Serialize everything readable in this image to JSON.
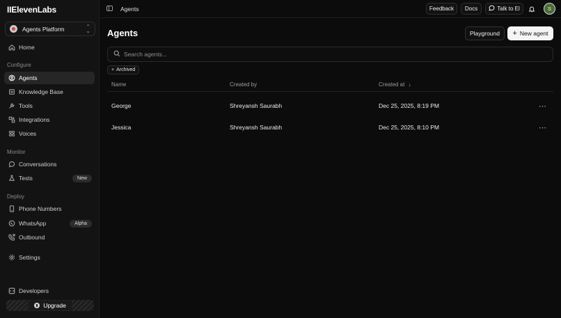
{
  "app": {
    "logo": "IIElevenLabs",
    "workspace": "Agents Platform"
  },
  "sidebar": {
    "home": "Home",
    "configure_label": "Configure",
    "configure": [
      "Agents",
      "Knowledge Base",
      "Tools",
      "Integrations",
      "Voices"
    ],
    "monitor_label": "Monitor",
    "conversations": "Conversations",
    "tests": "Tests",
    "tests_badge": "New",
    "deploy_label": "Deploy",
    "phone_numbers": "Phone Numbers",
    "whatsapp": "WhatsApp",
    "whatsapp_badge": "Alpha",
    "outbound": "Outbound",
    "settings": "Settings",
    "developers": "Developers",
    "upgrade": "Upgrade"
  },
  "topbar": {
    "breadcrumb": "Agents",
    "feedback": "Feedback",
    "docs": "Docs",
    "talk": "Talk to El",
    "avatar_initial": "S"
  },
  "main": {
    "title": "Agents",
    "playground": "Playground",
    "new_agent": "New agent",
    "search_placeholder": "Search agents...",
    "archived": "Archived",
    "columns": {
      "name": "Name",
      "created_by": "Created by",
      "created_at": "Created at"
    },
    "rows": [
      {
        "name": "George",
        "created_by": "Shreyansh Saurabh",
        "created_at": "Dec 25, 2025, 8:19 PM"
      },
      {
        "name": "Jessica",
        "created_by": "Shreyansh Saurabh",
        "created_at": "Dec 25, 2025, 8:10 PM"
      }
    ]
  },
  "colors": {
    "background": "#0c0c0c",
    "sidebar": "#131313",
    "primary_button": "#f5f5f5",
    "avatar": "#4a6b3a"
  }
}
